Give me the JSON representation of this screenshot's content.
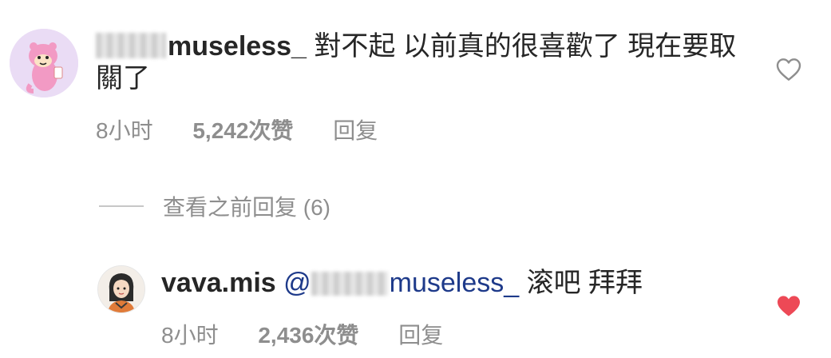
{
  "comment": {
    "username": "museless_",
    "text": "對不起 以前真的很喜歡了 現在要取關了",
    "time": "8小时",
    "likes": "5,242次赞",
    "reply_label": "回复"
  },
  "view_previous": {
    "label": "查看之前回复 (6)"
  },
  "reply": {
    "username": "vava.mis",
    "mention_prefix": "@",
    "mention_name": "museless_",
    "text": "滚吧 拜拜",
    "time": "8小时",
    "likes": "2,436次赞",
    "reply_label": "回复"
  },
  "colors": {
    "text": "#262626",
    "meta": "#8e8e8e",
    "mention": "#1e3a8a",
    "heart_liked": "#ed4956"
  },
  "icons": {
    "like_outline": "heart-outline-icon",
    "like_filled": "heart-filled-icon"
  }
}
